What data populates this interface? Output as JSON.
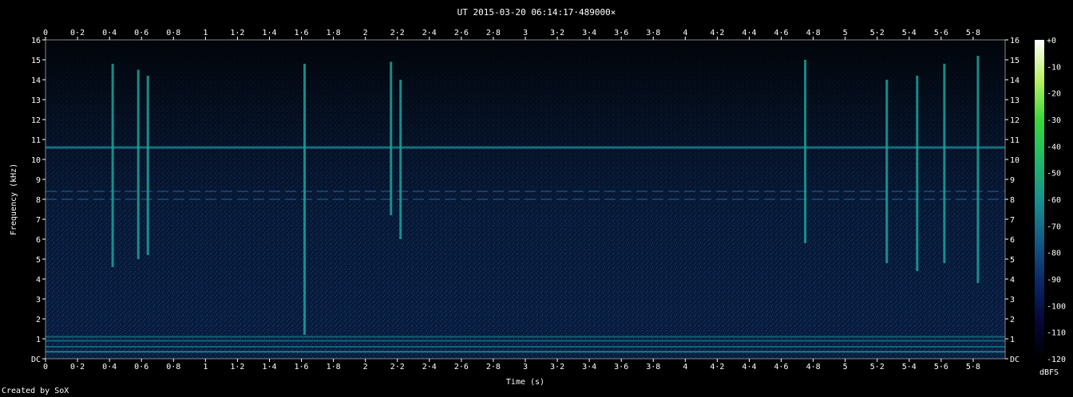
{
  "title": "UT 2015-03-20 06:14:17·489000×",
  "credit": "Created by SoX",
  "chart_data": {
    "type": "heatmap",
    "title": "UT 2015-03-20 06:14:17·489000×",
    "xlabel": "Time (s)",
    "ylabel": "Frequency (kHz)",
    "colorbar_label": "dBFS",
    "xlim": [
      0,
      6
    ],
    "ylim": [
      0,
      16
    ],
    "x_ticks": [
      "0",
      "0·2",
      "0·4",
      "0·6",
      "0·8",
      "1",
      "1·2",
      "1·4",
      "1·6",
      "1·8",
      "2",
      "2·2",
      "2·4",
      "2·6",
      "2·8",
      "3",
      "3·2",
      "3·4",
      "3·6",
      "3·8",
      "4",
      "4·2",
      "4·4",
      "4·6",
      "4·8",
      "5",
      "5·2",
      "5·4",
      "5·6",
      "5·8"
    ],
    "y_ticks": [
      "DC",
      "1",
      "2",
      "3",
      "4",
      "5",
      "6",
      "7",
      "8",
      "9",
      "10",
      "11",
      "12",
      "13",
      "14",
      "15",
      "16"
    ],
    "colorbar_ticks": [
      "+0",
      "-10",
      "-20",
      "-30",
      "-40",
      "-50",
      "-60",
      "-70",
      "-80",
      "-90",
      "-100",
      "-110",
      "-120"
    ],
    "colorbar_range": [
      -120,
      0
    ],
    "colors": {
      "background": "#000000",
      "noise": "#0b2a55",
      "tone": "#1aa39a",
      "hot": "#33ee66"
    },
    "tones_khz": [
      0.35,
      0.6,
      0.9,
      1.1,
      10.6
    ],
    "dashed_tones_khz": [
      8.0,
      8.4
    ],
    "vertical_events": [
      {
        "t": 0.42,
        "f_low": 4.6,
        "f_high": 14.8
      },
      {
        "t": 0.58,
        "f_low": 5.0,
        "f_high": 14.5
      },
      {
        "t": 0.64,
        "f_low": 5.2,
        "f_high": 14.2
      },
      {
        "t": 1.62,
        "f_low": 1.2,
        "f_high": 14.8
      },
      {
        "t": 2.16,
        "f_low": 7.2,
        "f_high": 14.9
      },
      {
        "t": 2.22,
        "f_low": 6.0,
        "f_high": 14.0
      },
      {
        "t": 4.75,
        "f_low": 5.8,
        "f_high": 15.0
      },
      {
        "t": 5.26,
        "f_low": 4.8,
        "f_high": 14.0
      },
      {
        "t": 5.45,
        "f_low": 4.4,
        "f_high": 14.2
      },
      {
        "t": 5.62,
        "f_low": 4.8,
        "f_high": 14.8
      },
      {
        "t": 5.83,
        "f_low": 3.8,
        "f_high": 15.2
      }
    ]
  }
}
